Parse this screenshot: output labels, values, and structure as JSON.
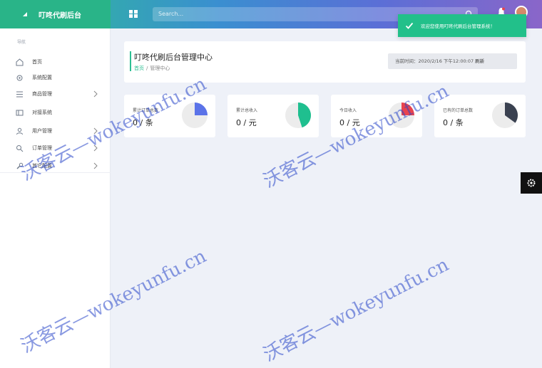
{
  "brand": {
    "title": "叮咚代刷后台"
  },
  "search": {
    "placeholder": "Search..."
  },
  "toast": {
    "message": "欢迎您使用叮咚代刷后台管理系统！"
  },
  "sidebar": {
    "heading": "导航",
    "items": [
      {
        "label": "首页",
        "icon": "home-icon",
        "has_children": false
      },
      {
        "label": "系统配置",
        "icon": "gear-icon",
        "has_children": false
      },
      {
        "label": "商品管理",
        "icon": "list-icon",
        "has_children": true
      },
      {
        "label": "对接系统",
        "icon": "card-icon",
        "has_children": false
      },
      {
        "label": "用户管理",
        "icon": "user-icon",
        "has_children": true
      },
      {
        "label": "订单管理",
        "icon": "search-icon",
        "has_children": true
      },
      {
        "label": "其它配置",
        "icon": "tool-icon",
        "has_children": true
      }
    ]
  },
  "header": {
    "title": "叮咚代刷后台管理中心",
    "breadcrumb_home": "首页",
    "breadcrumb_current": "管理中心",
    "time_label": "当前时间：",
    "time_value": "2020/2/16 下午12:00:07",
    "refresh": "刷新"
  },
  "stats": [
    {
      "label": "累计订单总数",
      "value": "0 / 条",
      "color": "#5b73e8",
      "fill": 0.25
    },
    {
      "label": "累计总收入",
      "value": "0 / 元",
      "color": "#1fbf8f",
      "fill": 0.45
    },
    {
      "label": "今日收入",
      "value": "0 / 元",
      "color": "#e8434f",
      "fill": 0.25
    },
    {
      "label": "已有的订单总数",
      "value": "0 / 条",
      "color": "#3a4150",
      "fill": 0.35
    }
  ],
  "colors": {
    "accent": "#2dbf93",
    "sidebar_bg": "#ffffff",
    "page_bg": "#eef1f8"
  },
  "watermark": "沃客云—wokeyunfu.cn"
}
